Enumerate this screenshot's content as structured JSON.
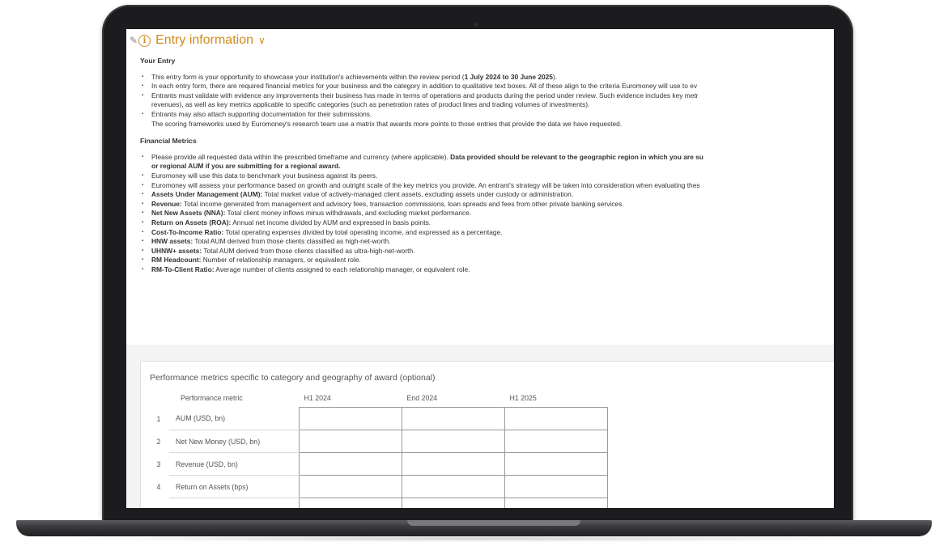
{
  "header": {
    "title": "Entry information",
    "edit_icon": "pencil-icon",
    "info_icon": "info-icon",
    "chevron_icon": "chevron-down-icon",
    "accent_color": "#d08a1e"
  },
  "your_entry": {
    "title": "Your Entry",
    "b1_a": "This entry form is your opportunity to showcase your institution's achievements within the review period (",
    "b1_bold": "1 July 2024 to 30 June 2025",
    "b1_c": ").",
    "b2": "In each entry form, there are required financial metrics for your business and the category in addition to qualitative text boxes. All of these align to the criteria Euromoney will use to ev",
    "b3_line1": "Entrants must validate with evidence any improvements their business has made in terms of operations and products during the period under review. Such evidence includes key metr",
    "b3_line2": "revenues), as well as key metrics applicable to specific categories (such as penetration rates of product lines and trading volumes of investments).",
    "b4_line1": "Entrants may also attach supporting documentation for their submissions.",
    "b4_line2": "The scoring frameworks used by Euromoney's research team use a matrix that awards more points to those entries that provide the data we have requested."
  },
  "financial_metrics": {
    "title": "Financial Metrics",
    "p1_a": "Please provide all requested data within the prescribed timeframe and currency (where applicable). ",
    "p1_bold1": "Data provided should be relevant to the geographic region in which you are su",
    "p1_bold2": "or regional AUM if you are submitting for a regional award.",
    "p2": "Euromoney will use this data to benchmark your business against its peers.",
    "p3": "Euromoney will assess your performance based on growth and outright scale of the key metrics you provide. An entrant's strategy will be taken into consideration when evaluating thes",
    "definitions": [
      {
        "term": "Assets Under Management (AUM):",
        "text": " Total market value of actively-managed client assets, excluding assets under custody or administration."
      },
      {
        "term": "Revenue:",
        "text": " Total income generated from management and advisory fees, transaction commissions, loan spreads and fees from other private banking services."
      },
      {
        "term": "Net New Assets (NNA):",
        "text": " Total client money inflows minus withdrawals, and excluding market performance."
      },
      {
        "term": "Return on Assets (ROA):",
        "text": " Annual net income divided by AUM and expressed in basis points."
      },
      {
        "term": "Cost-To-Income Ratio:",
        "text": " Total operating expenses divided by total operating income, and expressed as a percentage."
      },
      {
        "term": "HNW assets:",
        "text": " Total AUM derived from those clients classified as high-net-worth."
      },
      {
        "term": "UHNW+ assets:",
        "text": " Total AUM derived from those clients classified as ultra-high-net-worth."
      },
      {
        "term": "RM Headcount:",
        "text": " Number of relationship managers, or equivalent role."
      },
      {
        "term": "RM-To-Client Ratio:",
        "text": " Average number of clients assigned to each relationship manager, or equivalent role."
      }
    ]
  },
  "performance_table": {
    "title": "Performance metrics specific to category and geography of award (optional)",
    "columns": [
      "Performance metric",
      "H1 2024",
      "End 2024",
      "H1 2025"
    ],
    "rows": [
      {
        "num": "1",
        "metric": "AUM (USD, bn)"
      },
      {
        "num": "2",
        "metric": "Net New Money (USD, bn)"
      },
      {
        "num": "3",
        "metric": "Revenue (USD, bn)"
      },
      {
        "num": "4",
        "metric": "Return on Assets (bps)"
      }
    ]
  }
}
